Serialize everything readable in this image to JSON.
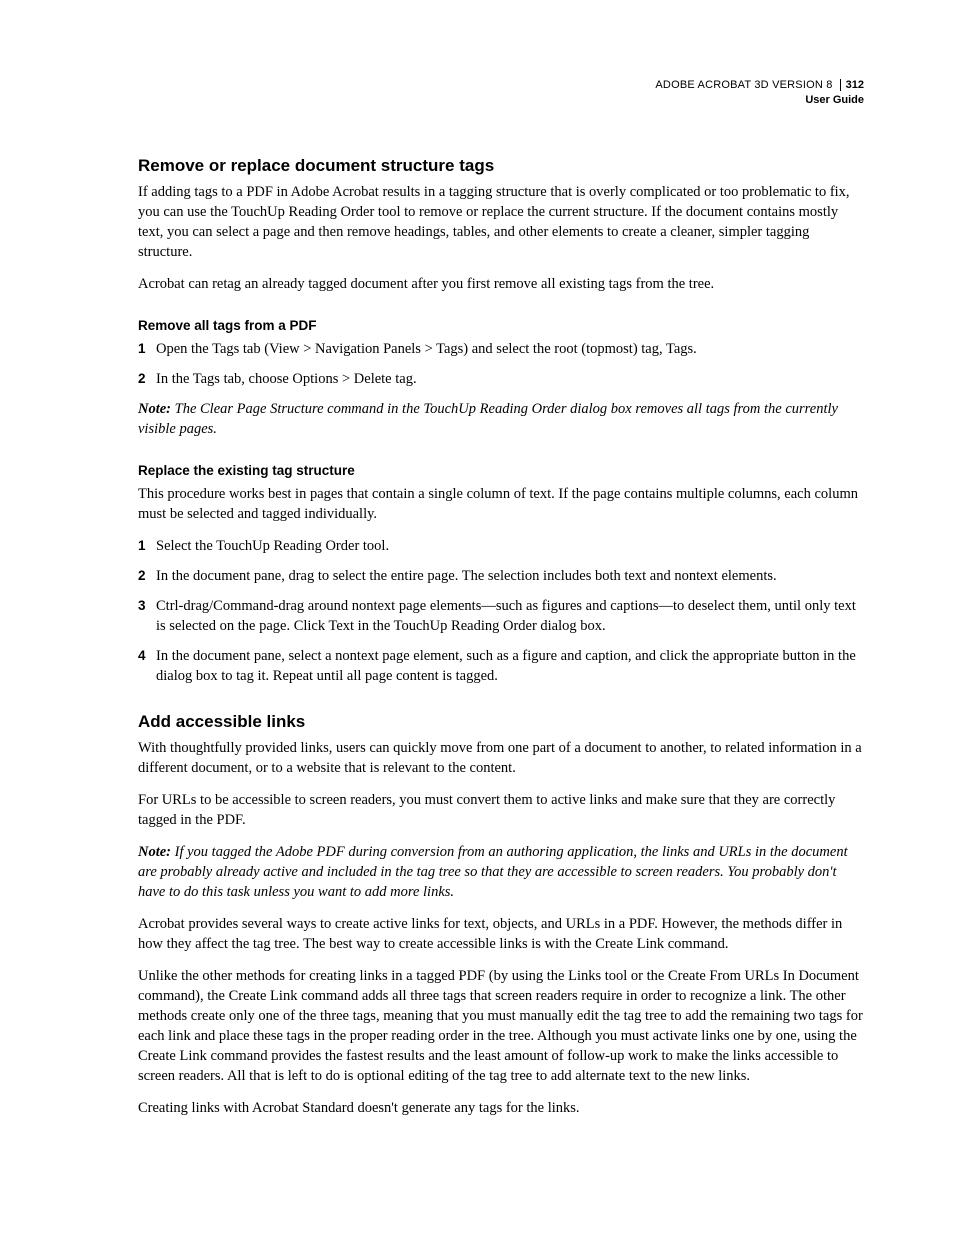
{
  "header": {
    "line1": "ADOBE ACROBAT 3D VERSION 8",
    "line2": "User Guide",
    "page": "312"
  },
  "s1": {
    "title": "Remove or replace document structure tags",
    "p1": "If adding tags to a PDF in Adobe Acrobat results in a tagging structure that is overly complicated or too problematic to fix, you can use the TouchUp Reading Order tool to remove or replace the current structure. If the document contains mostly text, you can select a page and then remove headings, tables, and other elements to create a cleaner, simpler tagging structure.",
    "p2": "Acrobat can retag an already tagged document after you first remove all existing tags from the tree.",
    "sub1": {
      "title": "Remove all tags from a PDF",
      "step1": "Open the Tags tab (View > Navigation Panels > Tags) and select the root (topmost) tag, Tags.",
      "step2": "In the Tags tab, choose Options > Delete tag.",
      "noteLabel": "Note:",
      "note": " The Clear Page Structure command in the TouchUp Reading Order dialog box removes all tags from the currently visible pages."
    },
    "sub2": {
      "title": "Replace the existing tag structure",
      "intro": "This procedure works best in pages that contain a single column of text. If the page contains multiple columns, each column must be selected and tagged individually.",
      "step1": "Select the TouchUp Reading Order tool.",
      "step2": "In the document pane, drag to select the entire page. The selection includes both text and nontext elements.",
      "step3": "Ctrl-drag/Command-drag around nontext page elements—such as figures and captions—to deselect them, until only text is selected on the page. Click Text in the TouchUp Reading Order dialog box.",
      "step4": "In the document pane, select a nontext page element, such as a figure and caption, and click the appropriate button in the dialog box to tag it. Repeat until all page content is tagged."
    }
  },
  "s2": {
    "title": "Add accessible links",
    "p1": "With thoughtfully provided links, users can quickly move from one part of a document to another, to related information in a different document, or to a website that is relevant to the content.",
    "p2": "For URLs to be accessible to screen readers, you must convert them to active links and make sure that they are correctly tagged in the PDF.",
    "noteLabel": "Note:",
    "note": " If you tagged the Adobe PDF during conversion from an authoring application, the links and URLs in the document are probably already active and included in the tag tree so that they are accessible to screen readers. You probably don't have to do this task unless you want to add more links.",
    "p3": "Acrobat provides several ways to create active links for text, objects, and URLs in a PDF. However, the methods differ in how they affect the tag tree. The best way to create accessible links is with the Create Link command.",
    "p4": "Unlike the other methods for creating links in a tagged PDF (by using the Links tool or the Create From URLs In Document command), the Create Link command adds all three tags that screen readers require in order to recognize a link. The other methods create only one of the three tags, meaning that you must manually edit the tag tree to add the remaining two tags for each link and place these tags in the proper reading order in the tree. Although you must activate links one by one, using the Create Link command provides the fastest results and the least amount of follow-up work to make the links accessible to screen readers. All that is left to do is optional editing of the tag tree to add alternate text to the new links.",
    "p5": "Creating links with Acrobat Standard doesn't generate any tags for the links."
  },
  "nums": {
    "n1": "1",
    "n2": "2",
    "n3": "3",
    "n4": "4"
  }
}
